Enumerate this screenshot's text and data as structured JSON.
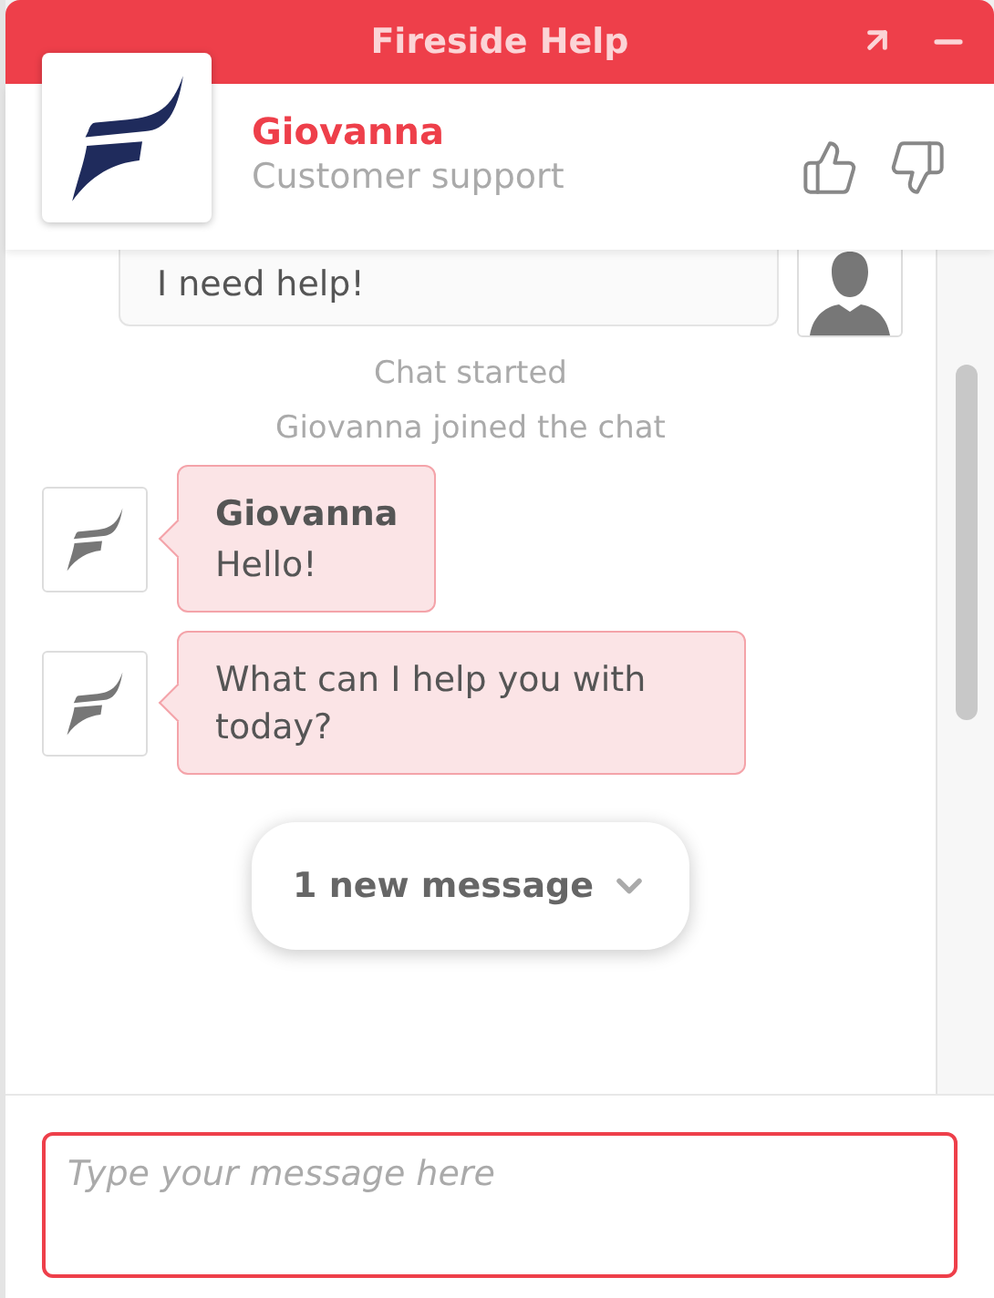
{
  "window": {
    "title": "Fireside Help"
  },
  "agent": {
    "name": "Giovanna",
    "role": "Customer support"
  },
  "messages": [
    {
      "kind": "user",
      "text": "I need help!"
    },
    {
      "kind": "system",
      "text": "Chat started"
    },
    {
      "kind": "system",
      "text": "Giovanna joined the chat"
    },
    {
      "kind": "agent",
      "sender": "Giovanna",
      "text": "Hello!"
    },
    {
      "kind": "agent",
      "text": "What can I help you with today?"
    }
  ],
  "new_messages": {
    "label": "1 new message"
  },
  "composer": {
    "placeholder": "Type your message here"
  }
}
